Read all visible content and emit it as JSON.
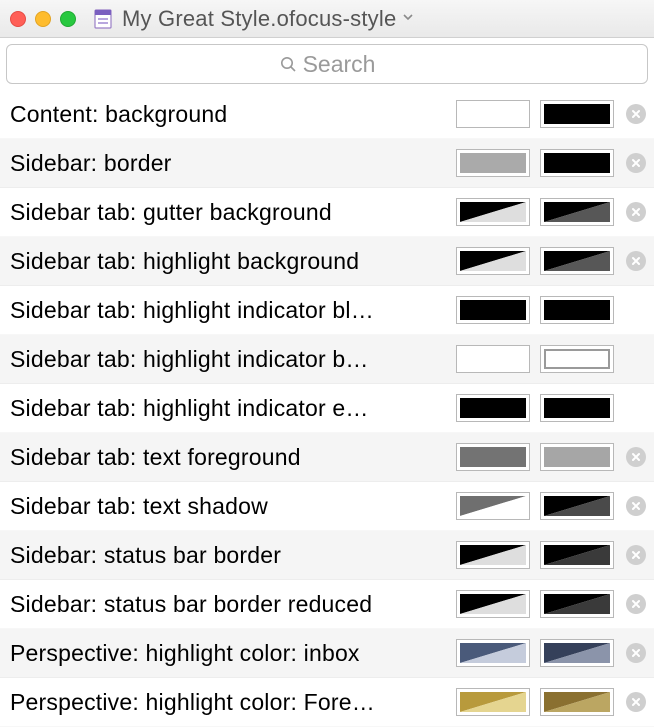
{
  "window": {
    "title": "My Great Style.ofocus-style"
  },
  "search": {
    "placeholder": "Search"
  },
  "rows": [
    {
      "label": "Content: background",
      "light": {
        "type": "solid",
        "fill": "#ffffff"
      },
      "dark": {
        "type": "solid",
        "fill": "#000000"
      },
      "removable": true
    },
    {
      "label": "Sidebar: border",
      "light": {
        "type": "solid",
        "fill": "#aaaaaa"
      },
      "dark": {
        "type": "solid",
        "fill": "#000000"
      },
      "removable": true
    },
    {
      "label": "Sidebar tab: gutter background",
      "light": {
        "type": "diag",
        "a": "#000000",
        "b": "#dedede"
      },
      "dark": {
        "type": "diag",
        "a": "#000000",
        "b": "#575757"
      },
      "removable": true
    },
    {
      "label": "Sidebar tab: highlight background",
      "light": {
        "type": "diag",
        "a": "#000000",
        "b": "#dedede"
      },
      "dark": {
        "type": "diag",
        "a": "#000000",
        "b": "#575757"
      },
      "removable": true
    },
    {
      "label": "Sidebar tab: highlight indicator bl…",
      "light": {
        "type": "solid",
        "fill": "#000000"
      },
      "dark": {
        "type": "solid",
        "fill": "#000000"
      },
      "removable": false
    },
    {
      "label": "Sidebar tab: highlight indicator b…",
      "light": {
        "type": "solid",
        "fill": "#ffffff"
      },
      "dark": {
        "type": "outline",
        "fill": "#ffffff"
      },
      "removable": false
    },
    {
      "label": "Sidebar tab: highlight indicator e…",
      "light": {
        "type": "solid",
        "fill": "#000000"
      },
      "dark": {
        "type": "solid",
        "fill": "#000000"
      },
      "removable": false
    },
    {
      "label": "Sidebar tab: text foreground",
      "light": {
        "type": "solid",
        "fill": "#737373"
      },
      "dark": {
        "type": "solid",
        "fill": "#a6a6a6"
      },
      "removable": true
    },
    {
      "label": "Sidebar tab: text shadow",
      "light": {
        "type": "diag",
        "a": "#6f6f6f",
        "b": "#ffffff"
      },
      "dark": {
        "type": "diag",
        "a": "#000000",
        "b": "#4a4a4a"
      },
      "removable": true
    },
    {
      "label": "Sidebar: status bar border",
      "light": {
        "type": "diag",
        "a": "#000000",
        "b": "#dedede"
      },
      "dark": {
        "type": "diag",
        "a": "#000000",
        "b": "#3a3a3a"
      },
      "removable": true
    },
    {
      "label": "Sidebar: status bar border reduced",
      "light": {
        "type": "diag",
        "a": "#000000",
        "b": "#dedede"
      },
      "dark": {
        "type": "diag",
        "a": "#000000",
        "b": "#3a3a3a"
      },
      "removable": true
    },
    {
      "label": "Perspective: highlight color: inbox",
      "light": {
        "type": "diag",
        "a": "#4a5a7a",
        "b": "#c5ccdc"
      },
      "dark": {
        "type": "diag",
        "a": "#35405a",
        "b": "#8b94aa"
      },
      "removable": true
    },
    {
      "label": "Perspective: highlight color: Fore…",
      "light": {
        "type": "diag",
        "a": "#b89a3c",
        "b": "#e5d590"
      },
      "dark": {
        "type": "diag",
        "a": "#8a7030",
        "b": "#bba662"
      },
      "removable": true
    }
  ]
}
